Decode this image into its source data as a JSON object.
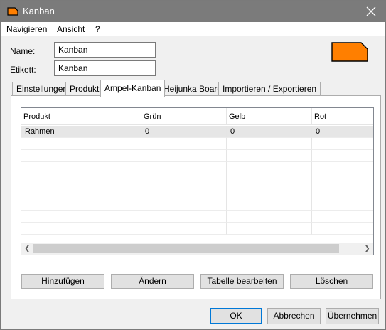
{
  "window": {
    "title": "Kanban",
    "icon": "kanban-card-icon",
    "close_icon": "close-icon"
  },
  "menu": [
    "Navigieren",
    "Ansicht",
    "?"
  ],
  "fields": {
    "name": {
      "label": "Name:",
      "value": "Kanban"
    },
    "etikett": {
      "label": "Etikett:",
      "value": "Kanban"
    }
  },
  "logo": {
    "icon": "kanban-card-icon",
    "color": "#ff7f00"
  },
  "tabs": [
    "Einstellungen",
    "Produkt",
    "Ampel-Kanban",
    "Heijunka Board",
    "Importieren / Exportieren"
  ],
  "active_tab": "Ampel-Kanban",
  "table": {
    "columns": [
      "Produkt",
      "Grün",
      "Gelb",
      "Rot"
    ],
    "rows": [
      [
        "Rahmen",
        "0",
        "0",
        "0"
      ]
    ],
    "scroll_left_icon": "chevron-left-icon",
    "scroll_right_icon": "chevron-right-icon"
  },
  "actions": {
    "add": "Hinzufügen",
    "edit": "Ändern",
    "edit_table": "Tabelle bearbeiten",
    "delete": "Löschen"
  },
  "dialog_buttons": {
    "ok": "OK",
    "cancel": "Abbrechen",
    "apply": "Übernehmen"
  },
  "colors": {
    "titlebar": "#7b7b7b",
    "accent": "#0078d7",
    "logo": "#ff7f00"
  }
}
